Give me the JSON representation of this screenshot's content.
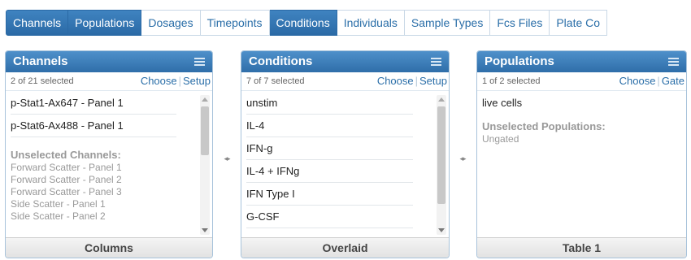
{
  "tabs": [
    {
      "label": "Channels",
      "active": true
    },
    {
      "label": "Populations",
      "active": true
    },
    {
      "label": "Dosages",
      "active": false
    },
    {
      "label": "Timepoints",
      "active": false
    },
    {
      "label": "Conditions",
      "active": true
    },
    {
      "label": "Individuals",
      "active": false
    },
    {
      "label": "Sample Types",
      "active": false
    },
    {
      "label": "Fcs Files",
      "active": false
    },
    {
      "label": "Plate Co",
      "active": false
    }
  ],
  "panels": {
    "channels": {
      "title": "Channels",
      "count": "2 of 21 selected",
      "links": [
        "Choose",
        "Setup"
      ],
      "selected": [
        "p-Stat1-Ax647 - Panel 1",
        "p-Stat6-Ax488 - Panel 1"
      ],
      "unselected_title": "Unselected Channels:",
      "unselected": [
        "Forward Scatter - Panel 1",
        "Forward Scatter - Panel 2",
        "Forward Scatter - Panel 3",
        "Side Scatter - Panel 1",
        "Side Scatter - Panel 2"
      ],
      "footer": "Columns"
    },
    "conditions": {
      "title": "Conditions",
      "count": "7 of 7 selected",
      "links": [
        "Choose",
        "Setup"
      ],
      "selected": [
        "unstim",
        "IL-4",
        "IFN-g",
        "IL-4 + IFNg",
        "IFN Type I",
        "G-CSF"
      ],
      "footer": "Overlaid"
    },
    "populations": {
      "title": "Populations",
      "count": "1 of 2 selected",
      "links": [
        "Choose",
        "Gate"
      ],
      "selected": [
        "live cells"
      ],
      "unselected_title": "Unselected Populations:",
      "unselected": [
        "Ungated"
      ],
      "footer": "Table 1"
    }
  },
  "icons": {
    "splitter": "◂▸",
    "menu": "hamburger-menu-icon"
  },
  "colors": {
    "accent": "#2b6aa6",
    "tab_text": "#2a6ea8",
    "muted": "#999999"
  }
}
